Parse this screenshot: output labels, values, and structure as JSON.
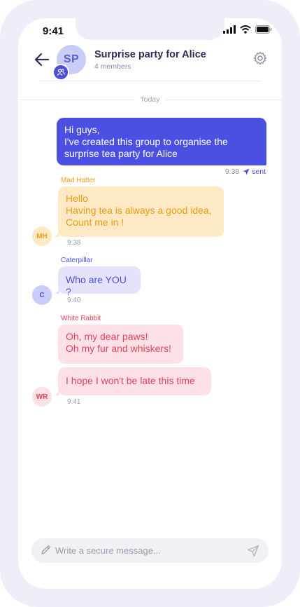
{
  "status_bar": {
    "time": "9:41"
  },
  "header": {
    "avatar_initials": "SP",
    "title": "Surprise party for Alice",
    "subtitle": "4 members"
  },
  "day_separator": "Today",
  "messages": [
    {
      "direction": "out",
      "lines": [
        "Hi guys,",
        "I've created this group to organise the",
        "surprise tea party for Alice"
      ],
      "time": "9:38",
      "status": "sent"
    },
    {
      "direction": "in",
      "sender": "Mad Hatter",
      "initials": "MH",
      "lines": [
        "Hello",
        "Having tea is always a good idea,",
        "Count me in !"
      ],
      "time": "9:38"
    },
    {
      "direction": "in",
      "sender": "Caterpillar",
      "initials": "C",
      "lines": [
        "Who are YOU ?"
      ],
      "time": "9:40"
    },
    {
      "direction": "in",
      "sender": "White Rabbit",
      "initials": "WR",
      "bubbles": [
        {
          "lines": [
            "Oh, my dear paws!",
            "Oh my fur and whiskers!"
          ]
        },
        {
          "lines": [
            "I hope I won't be late this time"
          ]
        }
      ],
      "time": "9:41"
    }
  ],
  "composer": {
    "placeholder": "Write a secure message..."
  },
  "colors": {
    "accent": "#4b50e3",
    "mad_hatter_bubble": "#fde9c3",
    "mad_hatter_text": "#f09a12",
    "caterpillar_bubble": "#e3e4fb",
    "caterpillar_text": "#4b50e3",
    "white_rabbit_bubble": "#fde1e6",
    "white_rabbit_text": "#e8405c"
  },
  "icons": {
    "back": "arrow-left-icon",
    "group": "group-icon",
    "settings": "gear-icon",
    "sent": "send-arrow-icon",
    "compose": "pencil-icon",
    "send": "send-icon"
  }
}
